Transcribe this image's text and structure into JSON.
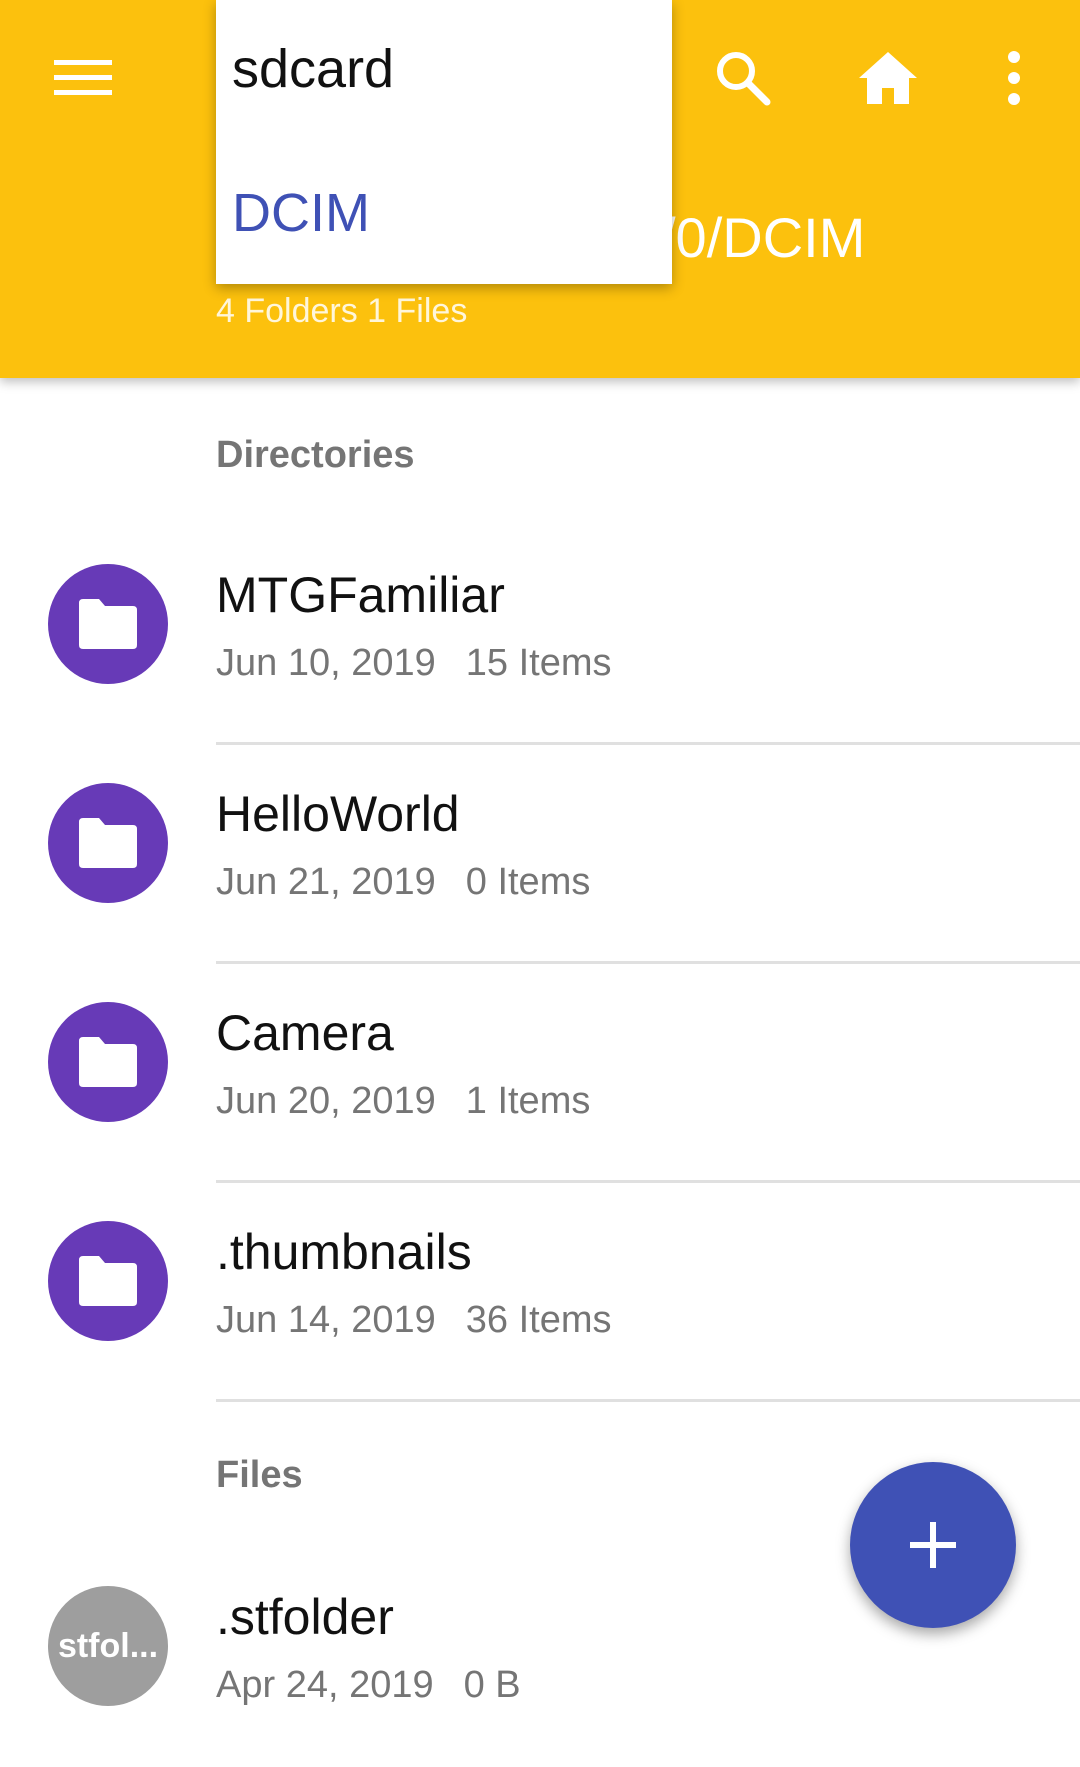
{
  "toolbar": {
    "menu_icon": "menu-icon",
    "search_icon": "search-icon",
    "home_icon": "home-icon",
    "more_icon": "more-vert-icon",
    "path": "/0/DCIM",
    "summary": "4 Folders 1 Files",
    "background_color": "#fcc10d"
  },
  "breadcrumb": {
    "root": "sdcard",
    "current": "DCIM",
    "current_color": "#3f51b5"
  },
  "directories": {
    "header": "Directories",
    "items": [
      {
        "name": "MTGFamiliar",
        "date": "Jun 10, 2019",
        "count": "15 Items",
        "icon": "folder-icon"
      },
      {
        "name": "HelloWorld",
        "date": "Jun 21, 2019",
        "count": "0 Items",
        "icon": "folder-icon"
      },
      {
        "name": "Camera",
        "date": "Jun 20, 2019",
        "count": "1 Items",
        "icon": "folder-icon"
      },
      {
        "name": ".thumbnails",
        "date": "Jun 14, 2019",
        "count": "36 Items",
        "icon": "folder-icon"
      }
    ],
    "folder_color": "#673ab7"
  },
  "files": {
    "header": "Files",
    "items": [
      {
        "name": ".stfolder",
        "date": "Apr 24, 2019",
        "size": "0 B",
        "avatar_text": "stfol..."
      }
    ]
  },
  "fab": {
    "icon": "plus-icon",
    "color": "#3f51b5"
  }
}
